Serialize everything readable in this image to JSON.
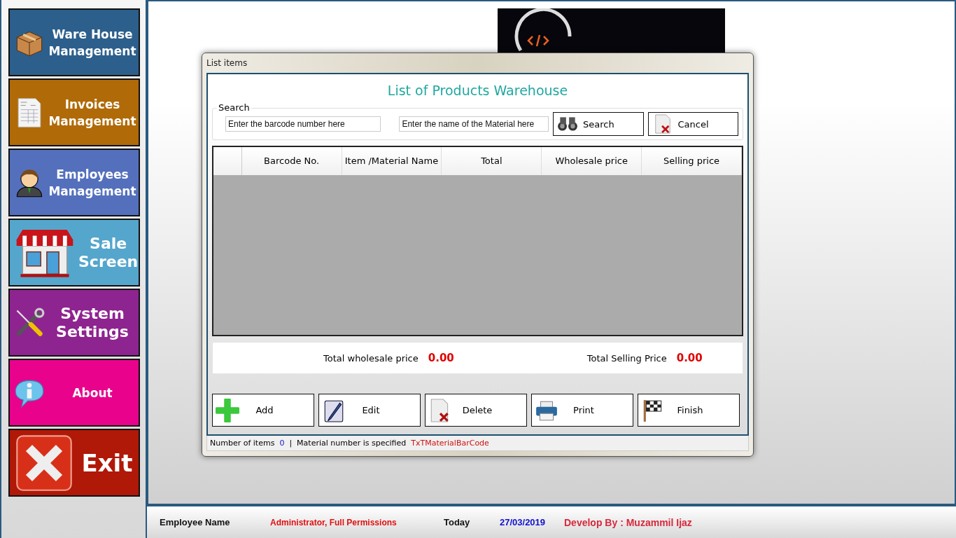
{
  "sidebar": {
    "items": [
      {
        "label": "Ware House Management",
        "kind": "box",
        "color": "#2c5f8c"
      },
      {
        "label": "Invoices Management",
        "kind": "invoice",
        "color": "#b06a08"
      },
      {
        "label": "Employees Management",
        "kind": "person",
        "color": "#5470bc"
      },
      {
        "label": "Sale Screen",
        "kind": "shop",
        "color": "#55a6cc"
      },
      {
        "label": "System Settings",
        "kind": "tools",
        "color": "#8e2490"
      },
      {
        "label": "About",
        "kind": "info",
        "color": "#e8028c"
      },
      {
        "label": "Exit",
        "kind": "exit",
        "color": "#b01808"
      }
    ]
  },
  "dialog": {
    "title": "List items",
    "heading": "List of Products Warehouse",
    "search": {
      "legend": "Search",
      "barcode": {
        "placeholder": "Enter the barcode number here"
      },
      "name": {
        "placeholder": "Enter the name of the Material here"
      },
      "buttons": [
        {
          "label": "Search",
          "kind": "search"
        },
        {
          "label": "Cancel",
          "kind": "cancel"
        }
      ]
    },
    "table": {
      "columns": [
        "Barcode No.",
        "Item /Material Name",
        "Total",
        "Wholesale price",
        "Selling price"
      ]
    },
    "totals": [
      {
        "label": "Total wholesale price",
        "value": "0.00"
      },
      {
        "label": "Total Selling Price",
        "value": "0.00"
      }
    ],
    "buttons": [
      {
        "label": "Add",
        "kind": "add"
      },
      {
        "label": "Edit",
        "kind": "edit"
      },
      {
        "label": "Delete",
        "kind": "delete"
      },
      {
        "label": "Print",
        "kind": "print"
      },
      {
        "label": "Finish",
        "kind": "finish"
      }
    ],
    "status_bar": {
      "items_label": "Number of items",
      "items_value": "0",
      "separator": "|",
      "material_label": "Material number is specified",
      "material_value": "TxTMaterialBarCode"
    }
  },
  "status_bar": {
    "employee_label": "Employee Name",
    "employee_value": "Administrator, Full Permissions",
    "today_label": "Today",
    "date": "27/03/2019",
    "developer": "Develop By : Muzammil Ijaz"
  }
}
